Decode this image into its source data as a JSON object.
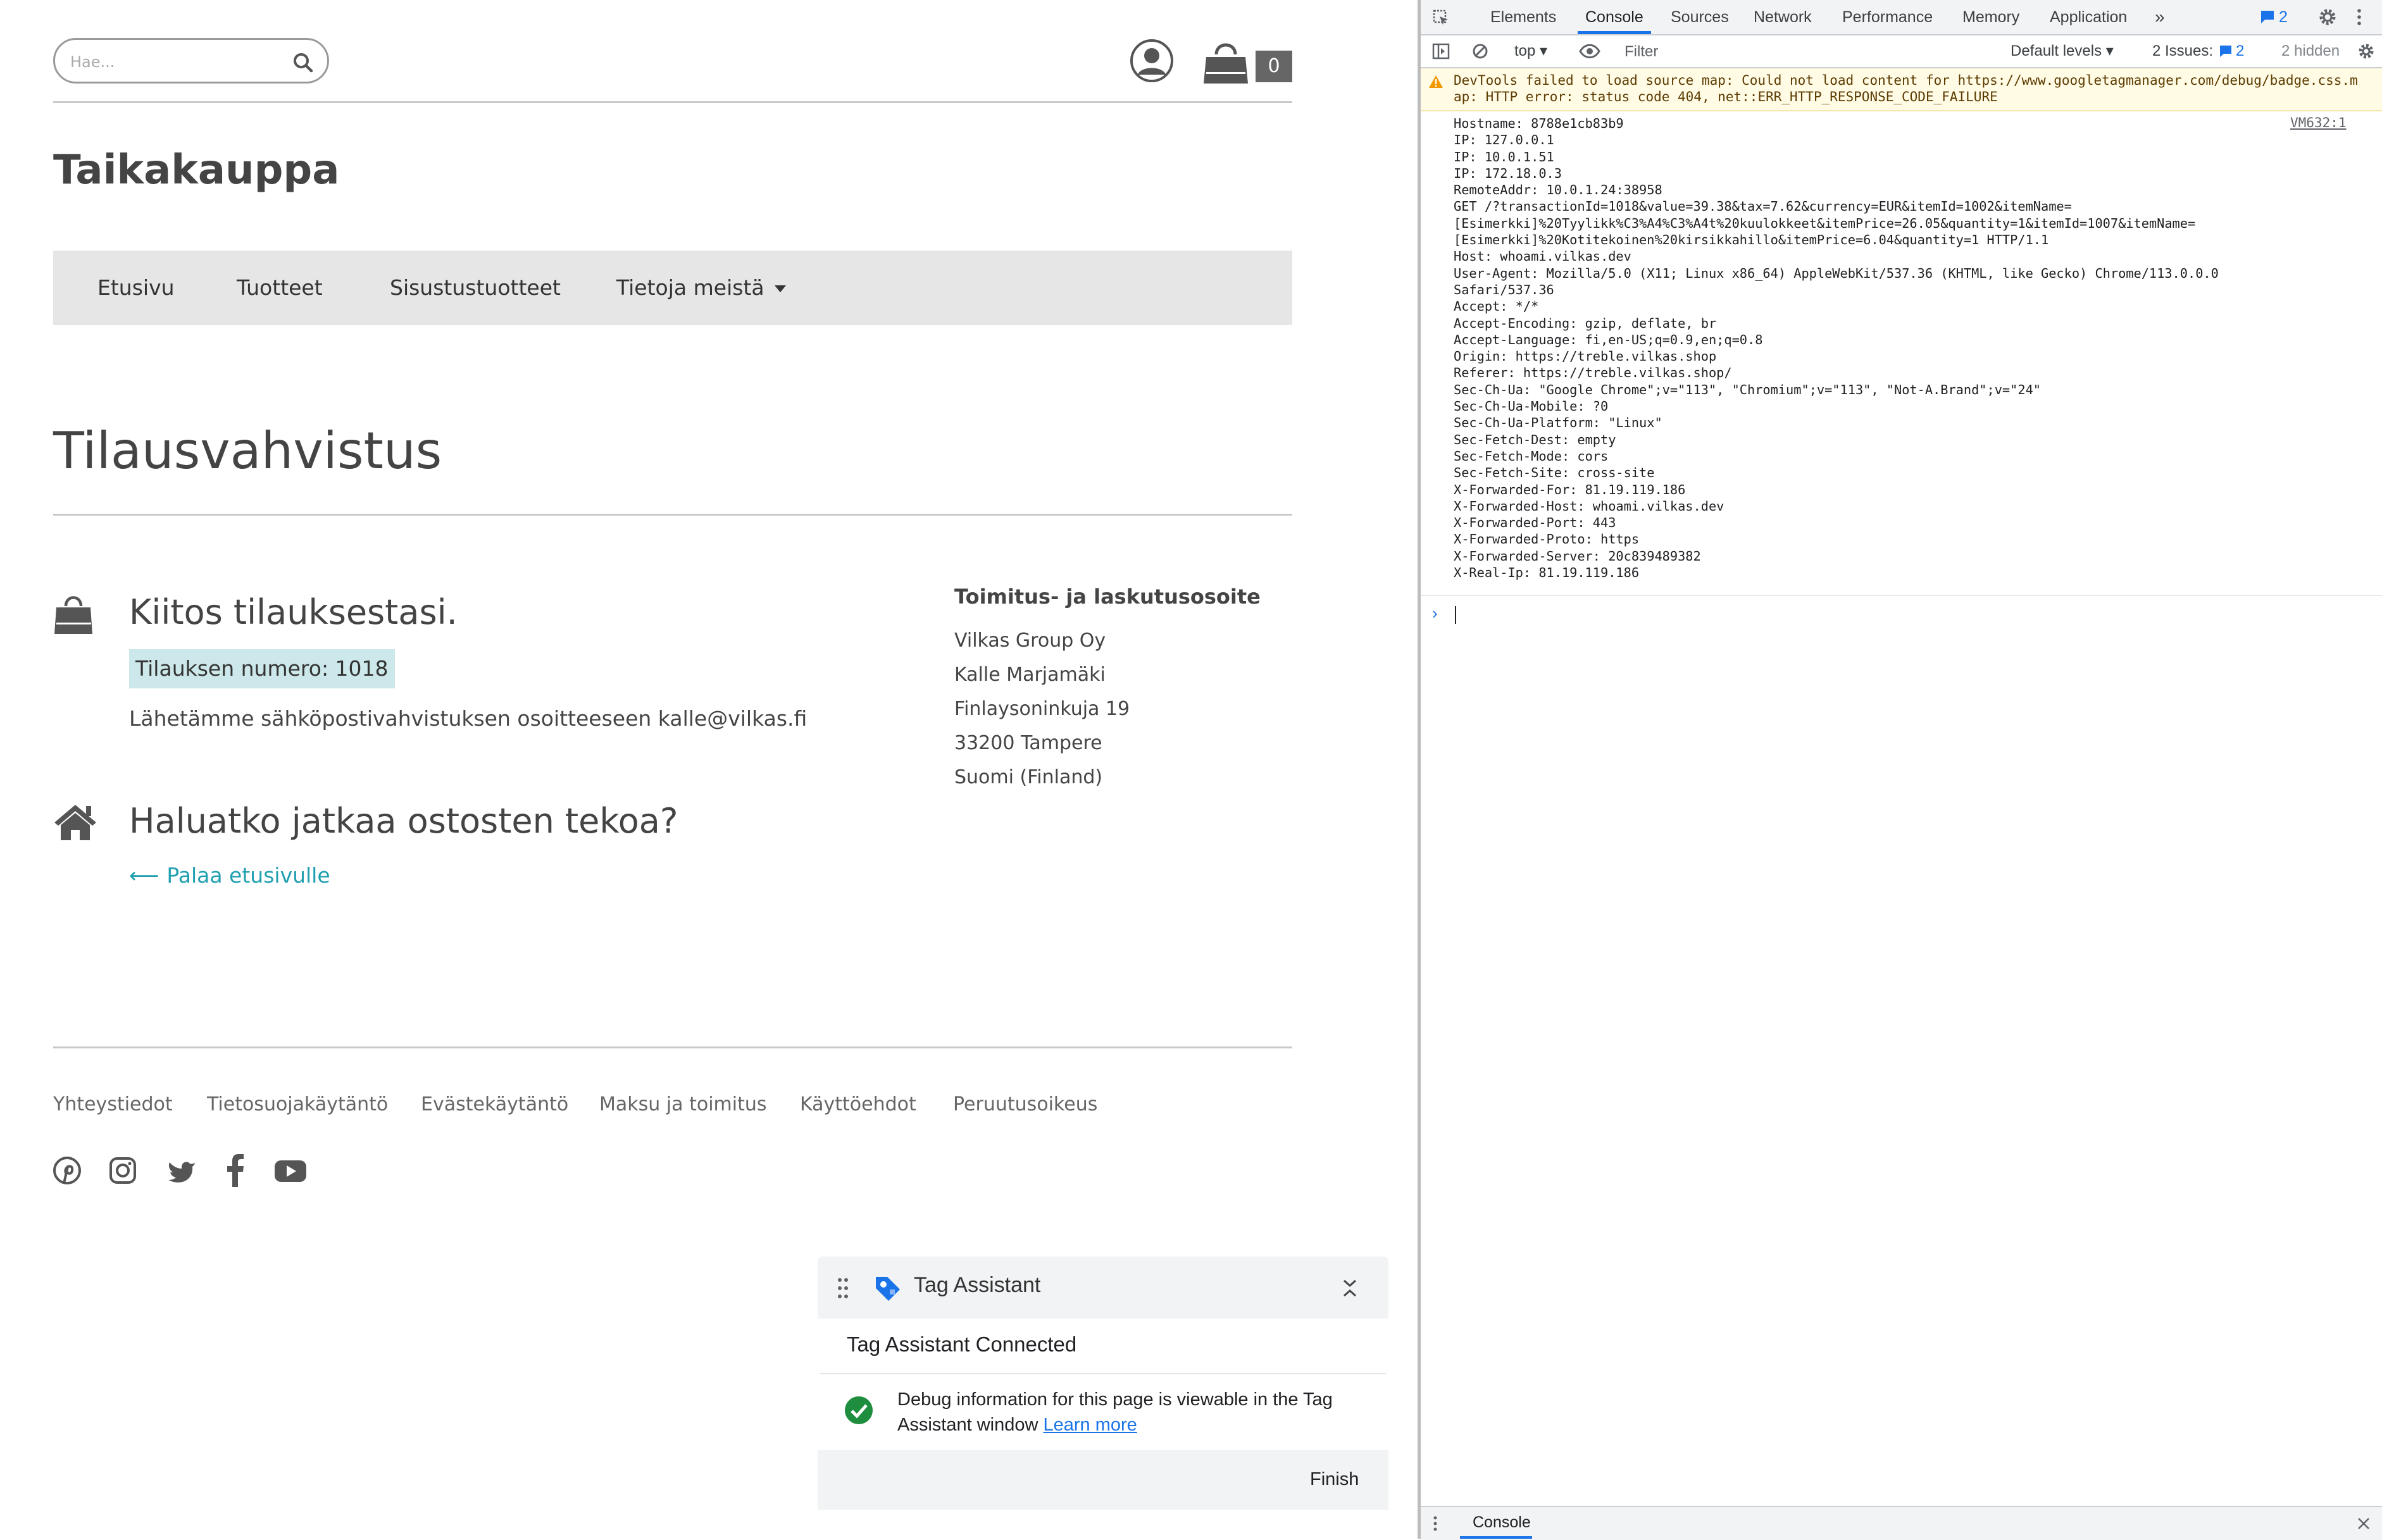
{
  "store": {
    "search": {
      "placeholder": "Hae..."
    },
    "cart": {
      "count": "0"
    },
    "site_title": "Taikakauppa",
    "nav": {
      "items": [
        {
          "label": "Etusivu"
        },
        {
          "label": "Tuotteet"
        },
        {
          "label": "Sisustustuotteet"
        },
        {
          "label": "Tietoja meistä"
        }
      ]
    },
    "page_title": "Tilausvahvistus",
    "confirmation": {
      "thanks": "Kiitos tilauksestasi.",
      "order_number": "Tilauksen numero: 1018",
      "email_note": "Lähetämme sähköpostivahvistuksen osoitteeseen kalle@vilkas.fi"
    },
    "continue": {
      "title": "Haluatko jatkaa ostosten tekoa?",
      "back_link": "Palaa etusivulle"
    },
    "address": {
      "title": "Toimitus- ja laskutusosoite",
      "lines": [
        "Vilkas Group Oy",
        "Kalle Marjamäki",
        "Finlaysoninkuja 19",
        "33200 Tampere",
        "Suomi (Finland)"
      ]
    },
    "footer": {
      "links": [
        {
          "label": "Yhteystiedot"
        },
        {
          "label": "Tietosuojakäytäntö"
        },
        {
          "label": "Evästekäytäntö"
        },
        {
          "label": "Maksu ja toimitus"
        },
        {
          "label": "Käyttöehdot"
        },
        {
          "label": "Peruutusoikeus"
        }
      ],
      "social": [
        "pinterest-icon",
        "instagram-icon",
        "twitter-icon",
        "facebook-icon",
        "youtube-icon"
      ]
    },
    "colors": {
      "accent": "#1f9fb0",
      "order_highlight": "#cde8ea",
      "nav_bg": "#e6e6e6"
    }
  },
  "tag_assistant": {
    "title": "Tag Assistant",
    "status": "Tag Assistant Connected",
    "message": "Debug information for this page is viewable in the Tag Assistant window",
    "learn_more": "Learn more",
    "finish": "Finish"
  },
  "devtools": {
    "tabs": [
      {
        "label": "Elements"
      },
      {
        "label": "Console"
      },
      {
        "label": "Sources"
      },
      {
        "label": "Network"
      },
      {
        "label": "Performance"
      },
      {
        "label": "Memory"
      },
      {
        "label": "Application"
      }
    ],
    "more_tabs": "»",
    "message_count": "2",
    "toolbar": {
      "context": "top",
      "filter_placeholder": "Filter",
      "levels": "Default levels",
      "issues_label": "2 Issues:",
      "issues_count": "2",
      "hidden": "2 hidden"
    },
    "warning": {
      "prefix": "DevTools failed to load source map: Could not load content for ",
      "url": "https://www.googletagmanager.com/debug/badge.css.map",
      "suffix": ": HTTP error: status code 404, net::ERR_HTTP_RESPONSE_CODE_FAILURE"
    },
    "log_source": "VM632:1",
    "log_lines": [
      "Hostname: 8788e1cb83b9",
      "IP: 127.0.0.1",
      "IP: 10.0.1.51",
      "IP: 172.18.0.3",
      "RemoteAddr: 10.0.1.24:38958",
      "GET /?transactionId=1018&value=39.38&tax=7.62&currency=EUR&itemId=1002&itemName=",
      "[Esimerkki]%20Tyylikk%C3%A4%C3%A4t%20kuulokkeet&itemPrice=26.05&quantity=1&itemId=1007&itemName=",
      "[Esimerkki]%20Kotitekoinen%20kirsikkahillo&itemPrice=6.04&quantity=1 HTTP/1.1",
      "Host: whoami.vilkas.dev",
      "User-Agent: Mozilla/5.0 (X11; Linux x86_64) AppleWebKit/537.36 (KHTML, like Gecko) Chrome/113.0.0.0",
      "Safari/537.36",
      "Accept: */*",
      "Accept-Encoding: gzip, deflate, br",
      "Accept-Language: fi,en-US;q=0.9,en;q=0.8",
      "Origin: https://treble.vilkas.shop",
      "Referer: https://treble.vilkas.shop/",
      "Sec-Ch-Ua: \"Google Chrome\";v=\"113\", \"Chromium\";v=\"113\", \"Not-A.Brand\";v=\"24\"",
      "Sec-Ch-Ua-Mobile: ?0",
      "Sec-Ch-Ua-Platform: \"Linux\"",
      "Sec-Fetch-Dest: empty",
      "Sec-Fetch-Mode: cors",
      "Sec-Fetch-Site: cross-site",
      "X-Forwarded-For: 81.19.119.186",
      "X-Forwarded-Host: whoami.vilkas.dev",
      "X-Forwarded-Port: 443",
      "X-Forwarded-Proto: https",
      "X-Forwarded-Server: 20c839489382",
      "X-Real-Ip: 81.19.119.186"
    ],
    "drawer_tab": "Console",
    "colors": {
      "active_tab": "#1a73e8",
      "warning_bg": "#fffbe5",
      "warning_text": "#5c3b00"
    }
  }
}
